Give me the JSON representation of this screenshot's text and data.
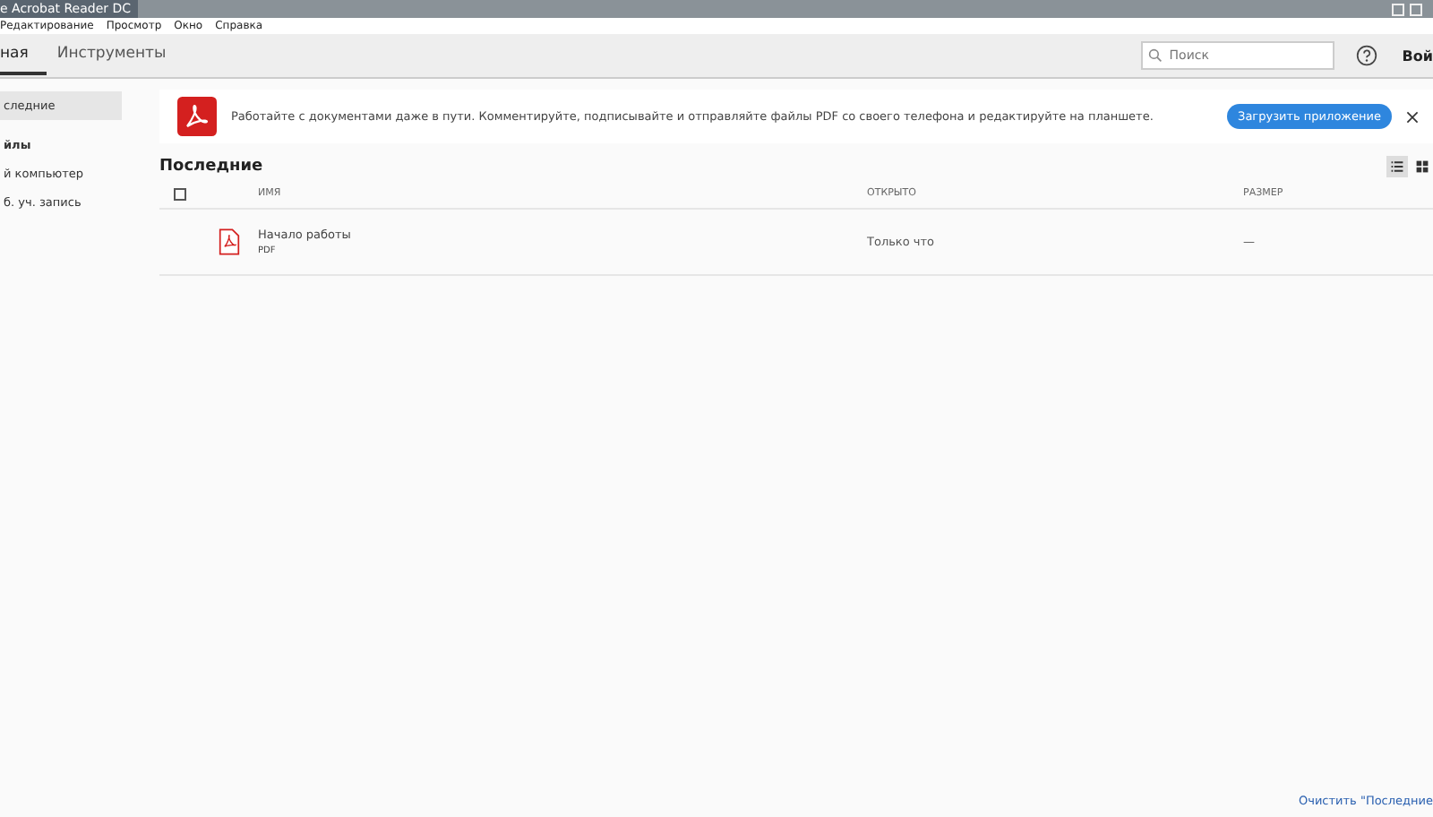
{
  "window": {
    "title": "e Acrobat Reader DC"
  },
  "menu": [
    "Редактирование",
    "Просмотр",
    "Окно",
    "Справка"
  ],
  "tabs": [
    {
      "label": "ная",
      "selected": true
    },
    {
      "label": "Инструменты",
      "selected": false
    }
  ],
  "search": {
    "placeholder": "Поиск"
  },
  "sign_in": "Вой",
  "sidebar": {
    "items": [
      {
        "label": "следние",
        "kind": "item",
        "selected": true
      },
      {
        "label": "йлы",
        "kind": "heading",
        "selected": false
      },
      {
        "label": "й компьютер",
        "kind": "item",
        "selected": false
      },
      {
        "label": "б. уч. запись",
        "kind": "item",
        "selected": false
      }
    ]
  },
  "banner": {
    "text": "Работайте с документами даже в пути. Комментируйте, подписывайте и отправляйте файлы PDF со своего телефона и редактируйте на планшете.",
    "button": "Загрузить приложение"
  },
  "section_title": "Последние",
  "view_modes": [
    {
      "kind": "list",
      "selected": true
    },
    {
      "kind": "grid",
      "selected": false
    }
  ],
  "table": {
    "columns": [
      "ИМЯ",
      "ОТКРЫТО",
      "РАЗМЕР"
    ],
    "select_all_checked": false,
    "rows": [
      {
        "name": "Начало работы",
        "type": "PDF",
        "opened": "Только что",
        "size": "—"
      }
    ]
  },
  "footer_link": "Очистить \"Последние"
}
